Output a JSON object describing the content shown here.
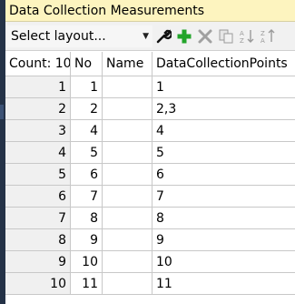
{
  "window": {
    "title": "Data Collection Measurements"
  },
  "toolbar": {
    "layout_select_value": "Select layout...",
    "icons": [
      "wrench-icon",
      "add-icon",
      "delete-icon",
      "copy-icon",
      "sort-ascending-icon",
      "sort-descending-icon"
    ]
  },
  "grid": {
    "headers": {
      "count": "Count: 10",
      "no": "No",
      "name": "Name",
      "dcp": "DataCollectionPoints"
    },
    "rows": [
      {
        "index": "1",
        "no": "1",
        "name": "",
        "dcp": "1"
      },
      {
        "index": "2",
        "no": "2",
        "name": "",
        "dcp": "2,3"
      },
      {
        "index": "3",
        "no": "4",
        "name": "",
        "dcp": "4"
      },
      {
        "index": "4",
        "no": "5",
        "name": "",
        "dcp": "5"
      },
      {
        "index": "5",
        "no": "6",
        "name": "",
        "dcp": "6"
      },
      {
        "index": "6",
        "no": "7",
        "name": "",
        "dcp": "7"
      },
      {
        "index": "7",
        "no": "8",
        "name": "",
        "dcp": "8"
      },
      {
        "index": "8",
        "no": "9",
        "name": "",
        "dcp": "9"
      },
      {
        "index": "9",
        "no": "10",
        "name": "",
        "dcp": "10"
      },
      {
        "index": "10",
        "no": "11",
        "name": "",
        "dcp": "11"
      }
    ]
  },
  "colors": {
    "title_bg": "#fdf4bf",
    "add_green": "#22a52a",
    "delete_gray": "#a0a0a0"
  }
}
